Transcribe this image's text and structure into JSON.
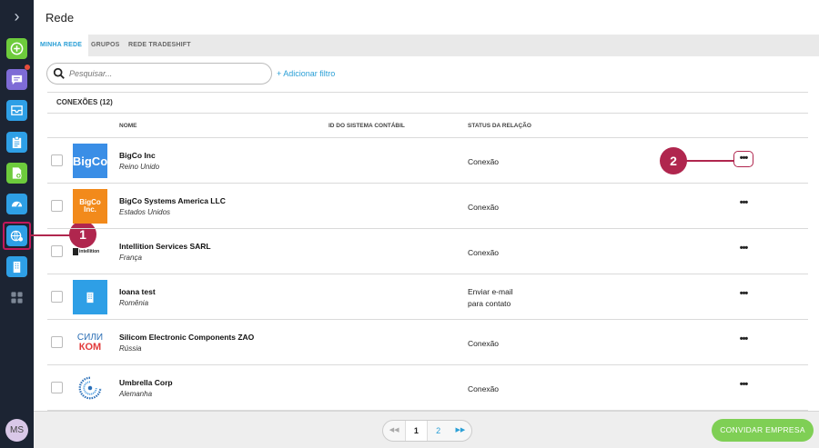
{
  "sidebar": {
    "items": [
      {
        "icon": "plus-circle-icon",
        "color": "#6dcb3c"
      },
      {
        "icon": "chat-icon",
        "color": "#7e6bd6"
      },
      {
        "icon": "inbox-icon",
        "color": "#2e9fe6"
      },
      {
        "icon": "clipboard-icon",
        "color": "#2e9fe6"
      },
      {
        "icon": "document-add-icon",
        "color": "#6dcb3c"
      },
      {
        "icon": "dashboard-icon",
        "color": "#2e9fe6"
      },
      {
        "icon": "network-globe-icon",
        "color": "#2e9fe6"
      },
      {
        "icon": "building-icon",
        "color": "#2e9fe6"
      },
      {
        "icon": "apps-grid-icon",
        "color": "#7d8796"
      }
    ],
    "avatar": "MS"
  },
  "callouts": {
    "one": "1",
    "two": "2"
  },
  "header": {
    "title": "Rede"
  },
  "tabs": [
    "MINHA REDE",
    "GRUPOS",
    "REDE TRADESHIFT"
  ],
  "search": {
    "placeholder": "Pesquisar...",
    "add_filter": "+ Adicionar filtro"
  },
  "connections": {
    "title": "CONEXÕES (12)",
    "columns": [
      "NOME",
      "ID DO SISTEMA CONTÁBIL",
      "STATUS DA RELAÇÃO"
    ],
    "rows": [
      {
        "name": "BigCo Inc",
        "country": "Reino Unido",
        "status": "Conexão",
        "logo_text": "BigCo"
      },
      {
        "name": "BigCo Systems America LLC",
        "country": "Estados Unidos",
        "status": "Conexão",
        "logo_text": "BigCo\nInc."
      },
      {
        "name": "Intellition Services SARL",
        "country": "França",
        "status": "Conexão",
        "logo_text": "intellition"
      },
      {
        "name": "Ioana test",
        "country": "Romênia",
        "status_line1": "Enviar e-mail",
        "status_line2": "para contato"
      },
      {
        "name": "Silicom Electronic Components ZAO",
        "country": "Rússia",
        "status": "Conexão",
        "logo_line1": "СИЛИ",
        "logo_line2": "КОМ"
      },
      {
        "name": "Umbrella Corp",
        "country": "Alemanha",
        "status": "Conexão"
      }
    ],
    "more_label": "•••"
  },
  "pagination": {
    "first": "◀◀",
    "page1": "1",
    "page2": "2",
    "next": "▶▶"
  },
  "footer": {
    "invite": "CONVIDAR EMPRESA"
  }
}
